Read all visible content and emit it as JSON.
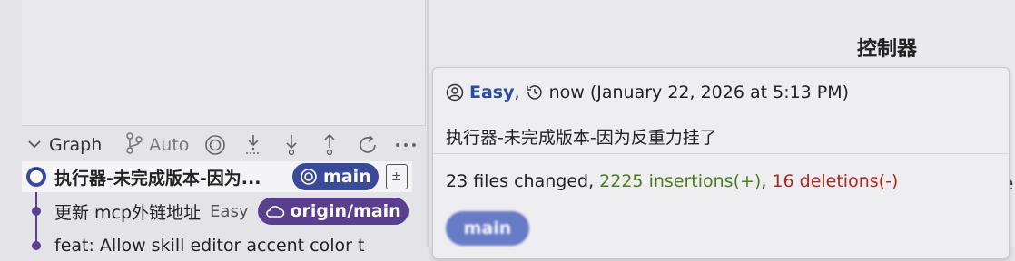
{
  "right_panel": {
    "title": "控制器",
    "peek_char": "e"
  },
  "graph_header": {
    "label": "Graph",
    "auto_label": "Auto"
  },
  "commits": [
    {
      "message": "执行器-未完成版本-因为...",
      "branch": "main",
      "selected": true
    },
    {
      "message": "更新 mcp外链地址",
      "author": "Easy",
      "branch": "origin/main"
    },
    {
      "message": "feat: Allow skill editor accent color t"
    }
  ],
  "popup": {
    "author": "Easy",
    "time": "now (January 22, 2026 at 5:13 PM)",
    "message": "执行器-未完成版本-因为反重力挂了",
    "files_changed": "23 files changed",
    "insertions": "2225 insertions(+)",
    "deletions": "16 deletions(-)",
    "branch": "main"
  },
  "colors": {
    "branch_main": "#3a4a9a",
    "branch_origin": "#5a3f8e",
    "graph_line": "#5a3f8e",
    "insertions": "#4a7d1f",
    "deletions": "#b2261f",
    "author_link": "#2b4d9c"
  }
}
